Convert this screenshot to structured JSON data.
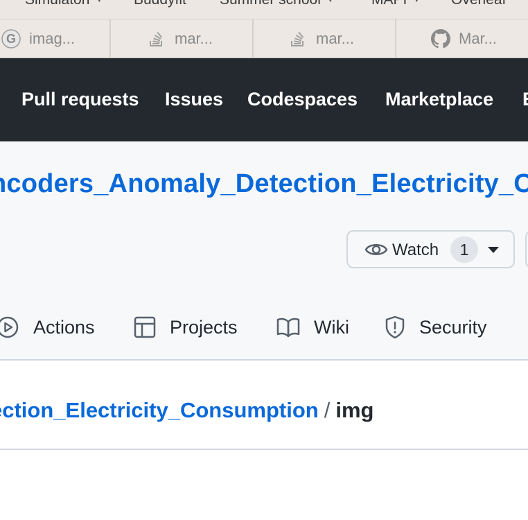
{
  "bookmarks": [
    {
      "label": "Simulaton",
      "has_dropdown": true
    },
    {
      "label": "Buddyfit",
      "has_dropdown": false
    },
    {
      "label": "Summer school",
      "has_dropdown": true
    },
    {
      "label": "MAPI",
      "has_dropdown": true
    },
    {
      "label": "Overleaf",
      "has_dropdown": false
    }
  ],
  "browser_tabs": [
    {
      "label": "imag...",
      "icon": "google-icon"
    },
    {
      "label": "mar...",
      "icon": "stackoverflow-icon"
    },
    {
      "label": "mar...",
      "icon": "stackoverflow-icon"
    },
    {
      "label": "Mar...",
      "icon": "github-icon"
    }
  ],
  "github_nav": [
    "Pull requests",
    "Issues",
    "Codespaces",
    "Marketplace",
    "E"
  ],
  "repo": {
    "title": "ncoders_Anomaly_Detection_Electricity_C",
    "watch_label": "Watch",
    "watch_count": "1"
  },
  "repo_tabs": [
    {
      "label": "Actions",
      "icon": "play-icon"
    },
    {
      "label": "Projects",
      "icon": "table-icon"
    },
    {
      "label": "Wiki",
      "icon": "book-icon"
    },
    {
      "label": "Security",
      "icon": "shield-icon"
    }
  ],
  "breadcrumb": {
    "repo_link": "ection_Electricity_Consumption",
    "separator": "/",
    "current": "img"
  },
  "colors": {
    "header_bg": "#24292f",
    "link": "#0969da",
    "repo_area_bg": "#f6f8fa",
    "border": "#d0d7de"
  }
}
